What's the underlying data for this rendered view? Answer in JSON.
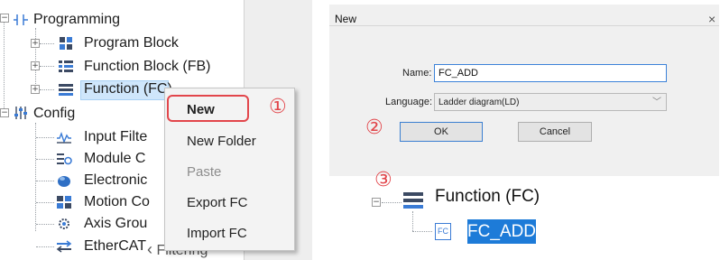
{
  "tree": {
    "root": {
      "label": "Programming",
      "icon": "programming-icon"
    },
    "items": [
      {
        "label": "Program Block",
        "icon": "program-block-icon"
      },
      {
        "label": "Function Block (FB)",
        "icon": "function-block-icon"
      },
      {
        "label": "Function (FC)",
        "icon": "function-icon"
      }
    ],
    "config": {
      "label": "Config",
      "icon": "config-icon"
    },
    "config_items": [
      {
        "label": "Input Filte",
        "icon": "input-filter-icon"
      },
      {
        "label": "Module C",
        "icon": "module-config-icon"
      },
      {
        "label": "Electronic",
        "icon": "electronic-cam-icon"
      },
      {
        "label": "Motion Co",
        "icon": "motion-control-icon"
      },
      {
        "label": "Axis Grou",
        "icon": "axis-group-icon"
      },
      {
        "label": "EtherCAT",
        "icon": "ethercat-icon"
      }
    ],
    "last_item_partial": "Filtering"
  },
  "context_menu": {
    "items": [
      {
        "label": "New",
        "enabled": true
      },
      {
        "label": "New Folder",
        "enabled": true
      },
      {
        "label": "Paste",
        "enabled": false
      },
      {
        "label": "Export FC",
        "enabled": true
      },
      {
        "label": "Import FC",
        "enabled": true
      }
    ]
  },
  "steps": {
    "one": "①",
    "two": "②",
    "three": "③"
  },
  "dialog": {
    "title": "New",
    "close": "×",
    "name_label": "Name:",
    "name_value": "FC_ADD",
    "language_label": "Language:",
    "language_value": "Ladder diagram(LD)",
    "ok": "OK",
    "cancel": "Cancel"
  },
  "result_tree": {
    "parent_label": "Function (FC)",
    "child_badge": "FC",
    "child_label": "FC_ADD"
  },
  "colors": {
    "highlight": "#e2464b",
    "selection": "#1d7bd8",
    "accent": "#3c82d8"
  }
}
